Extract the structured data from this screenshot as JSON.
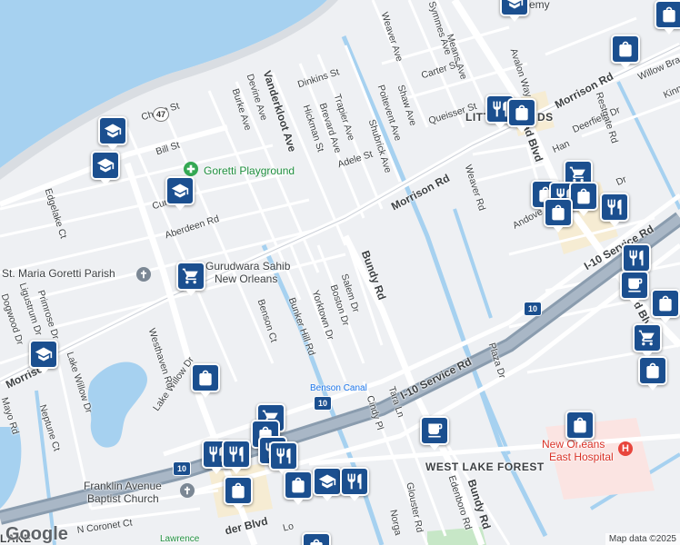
{
  "map": {
    "attribution": "Map data ©2025",
    "logo": "Google",
    "labels": {
      "neighborhoods": {
        "little_woods": "LITTLE WOODS",
        "west_lake_forest": "WEST LAKE FOREST",
        "lake_partial": "LAKE"
      },
      "pois": {
        "goretti_playground": "Goretti Playground",
        "gurudwara_line1": "Gurudwara Sahib",
        "gurudwara_line2": "New Orleans",
        "st_maria_goretti": "St. Maria Goretti Parish",
        "franklin_church_line1": "Franklin Avenue",
        "franklin_church_line2": "Baptist Church",
        "ne_east_hospital_line1": "New Orleans",
        "ne_east_hospital_line2": "East Hospital",
        "lawrence": "Lawrence",
        "academy_partial": "emy"
      },
      "water": {
        "benson_canal": "Benson Canal"
      },
      "roads": {
        "morrison_rd_1": "Morrison Rd",
        "morrison_rd_2": "Morrison Rd",
        "morrison_rd_left": "Morriso",
        "bundy_rd_1": "Bundy Rd",
        "bundy_rd_2": "Bundy Rd",
        "i10_service_rd_1": "I-10 Service Rd",
        "i10_service_rd_2": "I-10 Service Rd",
        "vanderkloot_ave": "Vanderkloot Ave",
        "read_blvd_1": "Read Blvd",
        "read_blvd_2": "Read Blvd",
        "read_blvd_partial": "der Blvd",
        "weaver_ave": "Weaver Ave",
        "weaver_rd": "Weaver Rd",
        "symmes_ave": "Symmes Ave",
        "means_ave": "Means Ave",
        "carter_st": "Carter St",
        "shaw_ave": "Shaw Ave",
        "poitevent_ave": "Poitevent Ave",
        "queisser_st": "Queisser St",
        "shubrick_ave": "Shubrick Ave",
        "adele_st": "Adele St",
        "dinkins_st": "Dinkins St",
        "trapier_ave": "Trapier Ave",
        "brevard_ave": "Brevard Ave",
        "hickman_st": "Hickman St",
        "devine_ave": "Devine Ave",
        "burke_ave": "Burke Ave",
        "chase_st": "Chase St",
        "bill_st": "Bill St",
        "edgelake_ct": "Edgelake Ct",
        "aberdeen_rd": "Aberdeen Rd",
        "benson_ct": "Benson Ct",
        "bunker_hill_rd": "Bunker Hill Rd",
        "yorktown_dr": "Yorktown Dr",
        "boston_dr": "Boston Dr",
        "salem_dr": "Salem Dr",
        "primrose_dr": "Primrose Dr",
        "ligustrum_dr": "Ligustrum Dr",
        "dogwood_dr": "Dogwood Dr",
        "lake_willow_dr_1": "Lake Willow Dr",
        "lake_willow_dr_2": "Lake Willow Dr",
        "westhaven_rd": "Westhaven Rd",
        "neptune_ct": "Neptune Ct",
        "mayo_rd": "Mayo Rd",
        "n_coronet_ct": "N Coronet Ct",
        "cindy_pl": "Cindy Pl",
        "tara_ln": "Tara Ln",
        "glouster_rd": "Glouster Rd",
        "edenboro_rd": "Edenboro Rd",
        "plaza_dr": "Plaza Dr",
        "andover_partial": "Andove",
        "deerfield_dr": "Deerfield Dr",
        "restgate_rd": "Restgate Rd",
        "avalon_way": "Avalon Way",
        "willow_brae": "Willow Brae",
        "kinn_partial": "Kinn",
        "cur_partial": "Cur",
        "norga_partial": "Norga",
        "dr_partial": "Dr",
        "han_partial": "Han",
        "lo_partial": "Lo",
        "lititle_partial": "LITTLE",
        "woods_partial": "WOODS"
      },
      "shields": {
        "i10_1": "10",
        "i10_2": "10",
        "i10_3": "10",
        "la47": "47"
      }
    },
    "icon_names": [
      "shopping-bag-icon",
      "school-icon",
      "restaurant-icon",
      "grocery-cart-icon",
      "coffee-icon",
      "place-of-worship-icon",
      "hospital-icon",
      "park-icon"
    ],
    "colors": {
      "water": "#a6d1f0",
      "land": "#eef0f3",
      "highway": "#8a9cae",
      "road": "#ffffff",
      "pin": "#1b4f8f",
      "hospital": "#e8453c",
      "park": "#34a853"
    }
  }
}
